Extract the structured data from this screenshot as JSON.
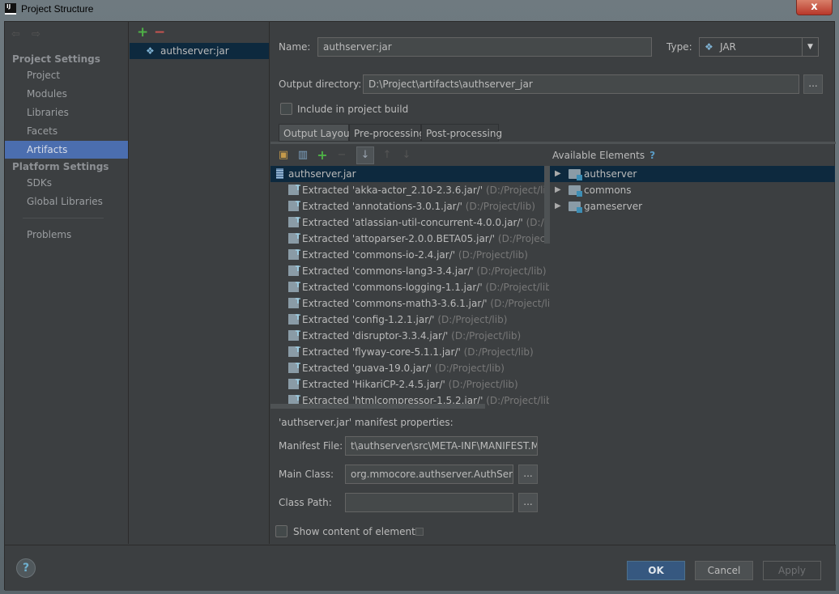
{
  "window": {
    "title": "Project Structure",
    "logo": "IJ",
    "close_label": "x"
  },
  "sidebar": {
    "nav_back": "⇦",
    "nav_forward": "⇨",
    "project_settings_header": "Project Settings",
    "project_items": [
      {
        "label": "Project",
        "selected": false
      },
      {
        "label": "Modules",
        "selected": false
      },
      {
        "label": "Libraries",
        "selected": false
      },
      {
        "label": "Facets",
        "selected": false
      },
      {
        "label": "Artifacts",
        "selected": true
      }
    ],
    "platform_settings_header": "Platform Settings",
    "platform_items": [
      {
        "label": "SDKs"
      },
      {
        "label": "Global Libraries"
      }
    ],
    "problems_label": "Problems"
  },
  "artifacts": {
    "add_label": "+",
    "remove_label": "−",
    "items": [
      {
        "label": "authserver:jar",
        "icon": "artifact-diamond-icon"
      }
    ]
  },
  "form": {
    "name_label": "Name:",
    "name_value": "authserver:jar",
    "type_label": "Type:",
    "type_value": "JAR",
    "output_dir_label": "Output directory:",
    "output_dir_value": "D:\\Project\\artifacts\\authserver_jar",
    "browse_label": "...",
    "include_label": "Include in project build",
    "include_checked": false
  },
  "tabs": [
    {
      "label": "Output Layout",
      "active": true
    },
    {
      "label": "Pre-processing",
      "active": false
    },
    {
      "label": "Post-processing",
      "active": false
    }
  ],
  "layout_tree": {
    "root": "authserver.jar",
    "prefix": "Extracted",
    "items": [
      {
        "name": "'akka-actor_2.10-2.3.6.jar/'",
        "path": "(D:/Project/lib)"
      },
      {
        "name": "'annotations-3.0.1.jar/'",
        "path": "(D:/Project/lib)"
      },
      {
        "name": "'atlassian-util-concurrent-4.0.0.jar/'",
        "path": "(D:/Project/lib)"
      },
      {
        "name": "'attoparser-2.0.0.BETA05.jar/'",
        "path": "(D:/Project/lib)"
      },
      {
        "name": "'commons-io-2.4.jar/'",
        "path": "(D:/Project/lib)"
      },
      {
        "name": "'commons-lang3-3.4.jar/'",
        "path": "(D:/Project/lib)"
      },
      {
        "name": "'commons-logging-1.1.jar/'",
        "path": "(D:/Project/lib)"
      },
      {
        "name": "'commons-math3-3.6.1.jar/'",
        "path": "(D:/Project/lib)"
      },
      {
        "name": "'config-1.2.1.jar/'",
        "path": "(D:/Project/lib)"
      },
      {
        "name": "'disruptor-3.3.4.jar/'",
        "path": "(D:/Project/lib)"
      },
      {
        "name": "'flyway-core-5.1.1.jar/'",
        "path": "(D:/Project/lib)"
      },
      {
        "name": "'guava-19.0.jar/'",
        "path": "(D:/Project/lib)"
      },
      {
        "name": "'HikariCP-2.4.5.jar/'",
        "path": "(D:/Project/lib)"
      },
      {
        "name": "'htmlcompressor-1.5.2.jar/'",
        "path": "(D:/Project/lib)"
      }
    ]
  },
  "available": {
    "title": "Available Elements",
    "help": "?",
    "items": [
      {
        "label": "authserver",
        "selected": true
      },
      {
        "label": "commons",
        "selected": false
      },
      {
        "label": "gameserver",
        "selected": false
      }
    ]
  },
  "manifest": {
    "title": "'authserver.jar' manifest properties:",
    "manifest_file_label": "Manifest File:",
    "manifest_file_value": "t\\authserver\\src\\META-INF\\MANIFEST.MF",
    "main_class_label": "Main Class:",
    "main_class_value": "org.mmocore.authserver.AuthServer",
    "class_path_label": "Class Path:",
    "class_path_value": "",
    "browse_label": "...",
    "show_content_label": "Show content of elements",
    "show_content_checked": false
  },
  "buttons": {
    "help": "?",
    "ok": "OK",
    "cancel": "Cancel",
    "apply": "Apply"
  }
}
